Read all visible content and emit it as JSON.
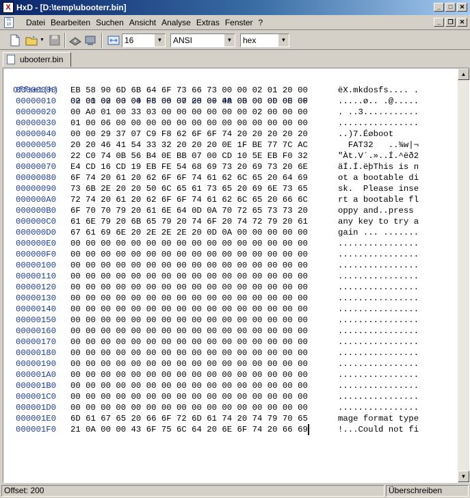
{
  "window": {
    "title": "HxD - [D:\\temp\\ubooterr.bin]",
    "app_icon": "hxd-app-icon"
  },
  "menu": [
    "Datei",
    "Bearbeiten",
    "Suchen",
    "Ansicht",
    "Analyse",
    "Extras",
    "Fenster",
    "?"
  ],
  "toolbar": {
    "bytes_per_row": "16",
    "charset": "ANSI",
    "display": "hex"
  },
  "tab": {
    "label": "ubooterr.bin"
  },
  "editor": {
    "header_offset": "Offset(h)",
    "header_columns": "00 01 02 03 04 05 06 07 08 09 0A 0B 0C 0D 0E 0F",
    "rows": [
      {
        "offset": "00000000",
        "hex": "EB 58 90 6D 6B 64 6F 73 66 73 00 00 02 01 20 00",
        "ascii": "ëX.mkdosfs.... ."
      },
      {
        "offset": "00000010",
        "hex": "02 00 00 00 00 F8 00 00 20 00 40 00 00 00 00 00",
        "ascii": ".....ø.. .@....."
      },
      {
        "offset": "00000020",
        "hex": "00 A0 01 00 33 03 00 00 00 00 00 00 02 00 00 00",
        "ascii": ". ..3..........."
      },
      {
        "offset": "00000030",
        "hex": "01 00 06 00 00 00 00 00 00 00 00 00 00 00 00 00",
        "ascii": "................"
      },
      {
        "offset": "00000040",
        "hex": "00 00 29 37 07 C9 F8 62 6F 6F 74 20 20 20 20 20",
        "ascii": "..)7.Éøboot     "
      },
      {
        "offset": "00000050",
        "hex": "20 20 46 41 54 33 32 20 20 20 0E 1F BE 77 7C AC",
        "ascii": "  FAT32   ..¾w|¬"
      },
      {
        "offset": "00000060",
        "hex": "22 C0 74 0B 56 B4 0E BB 07 00 CD 10 5E EB F0 32",
        "ascii": "\"Àt.V´.»..Í.^ëð2"
      },
      {
        "offset": "00000070",
        "hex": "E4 CD 16 CD 19 EB FE 54 68 69 73 20 69 73 20 6E",
        "ascii": "äÍ.Í.ëþThis is n"
      },
      {
        "offset": "00000080",
        "hex": "6F 74 20 61 20 62 6F 6F 74 61 62 6C 65 20 64 69",
        "ascii": "ot a bootable di"
      },
      {
        "offset": "00000090",
        "hex": "73 6B 2E 20 20 50 6C 65 61 73 65 20 69 6E 73 65",
        "ascii": "sk.  Please inse"
      },
      {
        "offset": "000000A0",
        "hex": "72 74 20 61 20 62 6F 6F 74 61 62 6C 65 20 66 6C",
        "ascii": "rt a bootable fl"
      },
      {
        "offset": "000000B0",
        "hex": "6F 70 70 79 20 61 6E 64 0D 0A 70 72 65 73 73 20",
        "ascii": "oppy and..press "
      },
      {
        "offset": "000000C0",
        "hex": "61 6E 79 20 6B 65 79 20 74 6F 20 74 72 79 20 61",
        "ascii": "any key to try a"
      },
      {
        "offset": "000000D0",
        "hex": "67 61 69 6E 20 2E 2E 2E 20 0D 0A 00 00 00 00 00",
        "ascii": "gain ... ......."
      },
      {
        "offset": "000000E0",
        "hex": "00 00 00 00 00 00 00 00 00 00 00 00 00 00 00 00",
        "ascii": "................"
      },
      {
        "offset": "000000F0",
        "hex": "00 00 00 00 00 00 00 00 00 00 00 00 00 00 00 00",
        "ascii": "................"
      },
      {
        "offset": "00000100",
        "hex": "00 00 00 00 00 00 00 00 00 00 00 00 00 00 00 00",
        "ascii": "................"
      },
      {
        "offset": "00000110",
        "hex": "00 00 00 00 00 00 00 00 00 00 00 00 00 00 00 00",
        "ascii": "................"
      },
      {
        "offset": "00000120",
        "hex": "00 00 00 00 00 00 00 00 00 00 00 00 00 00 00 00",
        "ascii": "................"
      },
      {
        "offset": "00000130",
        "hex": "00 00 00 00 00 00 00 00 00 00 00 00 00 00 00 00",
        "ascii": "................"
      },
      {
        "offset": "00000140",
        "hex": "00 00 00 00 00 00 00 00 00 00 00 00 00 00 00 00",
        "ascii": "................"
      },
      {
        "offset": "00000150",
        "hex": "00 00 00 00 00 00 00 00 00 00 00 00 00 00 00 00",
        "ascii": "................"
      },
      {
        "offset": "00000160",
        "hex": "00 00 00 00 00 00 00 00 00 00 00 00 00 00 00 00",
        "ascii": "................"
      },
      {
        "offset": "00000170",
        "hex": "00 00 00 00 00 00 00 00 00 00 00 00 00 00 00 00",
        "ascii": "................"
      },
      {
        "offset": "00000180",
        "hex": "00 00 00 00 00 00 00 00 00 00 00 00 00 00 00 00",
        "ascii": "................"
      },
      {
        "offset": "00000190",
        "hex": "00 00 00 00 00 00 00 00 00 00 00 00 00 00 00 00",
        "ascii": "................"
      },
      {
        "offset": "000001A0",
        "hex": "00 00 00 00 00 00 00 00 00 00 00 00 00 00 00 00",
        "ascii": "................"
      },
      {
        "offset": "000001B0",
        "hex": "00 00 00 00 00 00 00 00 00 00 00 00 00 00 00 00",
        "ascii": "................"
      },
      {
        "offset": "000001C0",
        "hex": "00 00 00 00 00 00 00 00 00 00 00 00 00 00 00 00",
        "ascii": "................"
      },
      {
        "offset": "000001D0",
        "hex": "00 00 00 00 00 00 00 00 00 00 00 00 00 00 00 00",
        "ascii": "................"
      },
      {
        "offset": "000001E0",
        "hex": "6D 61 67 65 20 66 6F 72 6D 61 74 20 74 79 70 65",
        "ascii": "mage format type"
      },
      {
        "offset": "000001F0",
        "hex": "21 0A 00 00 43 6F 75 6C 64 20 6E 6F 74 20 66 69",
        "ascii": "!...Could not fi"
      }
    ]
  },
  "status": {
    "offset": "Offset: 200",
    "mode": "Überschreiben"
  },
  "colors": {
    "offset_text": "#1a3aa0",
    "title_gradient_start": "#0a246a",
    "title_gradient_end": "#a6caf0"
  }
}
